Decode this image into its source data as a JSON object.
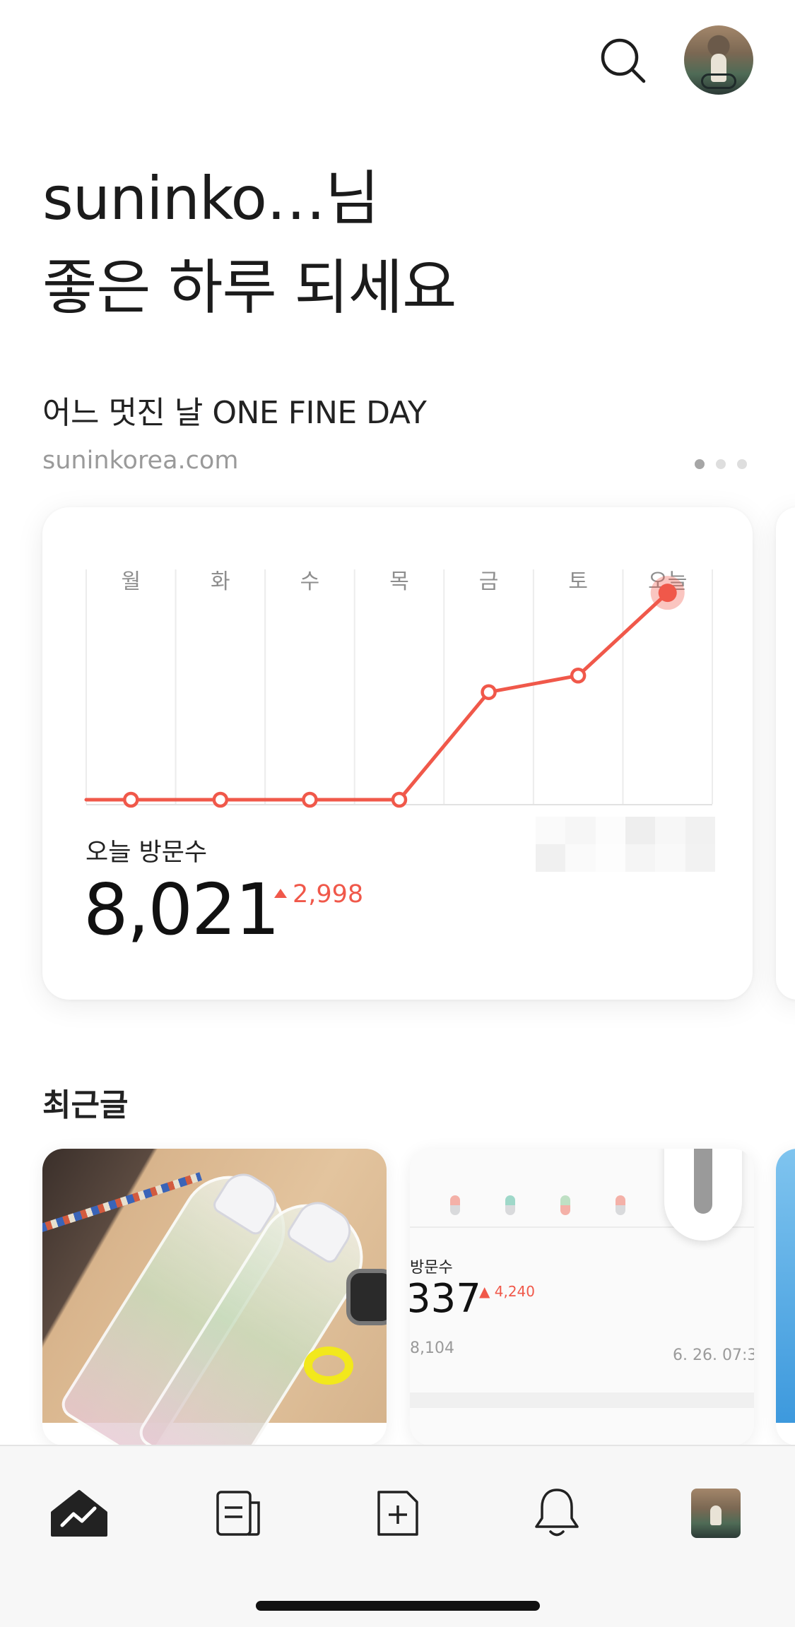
{
  "header": {
    "search_icon": "search-icon",
    "avatar_icon": "profile-avatar"
  },
  "greeting": {
    "line1": "suninko…님",
    "line2": "좋은 하루 되세요"
  },
  "blog": {
    "title": "어느 멋진 날 ONE FINE DAY",
    "url": "suninkorea.com",
    "pages": 3,
    "active_page": 1
  },
  "stats": {
    "visits_label": "오늘 방문수",
    "visits_value": "8,021",
    "visits_delta": "2,998",
    "colors": {
      "line": "#f0584a",
      "grid": "#ececec",
      "label": "#8e8e8e"
    }
  },
  "chart_data": {
    "type": "line",
    "categories": [
      "월",
      "화",
      "수",
      "목",
      "금",
      "토",
      "오늘"
    ],
    "series": [
      {
        "values": [
          0,
          0,
          0,
          0,
          2600,
          3000,
          5000
        ]
      }
    ],
    "ylim": [
      0,
      5600
    ],
    "grid": "vertical",
    "highlight_last": true
  },
  "recent": {
    "title": "최근글",
    "post2": {
      "label": "방문수",
      "value": "337",
      "delta": "4,240",
      "sub": "8,104",
      "time": "6. 26. 07:3"
    }
  },
  "tabbar": {
    "items": [
      "home-chart-icon",
      "posts-icon",
      "write-icon",
      "bell-icon",
      "profile-avatar"
    ]
  }
}
